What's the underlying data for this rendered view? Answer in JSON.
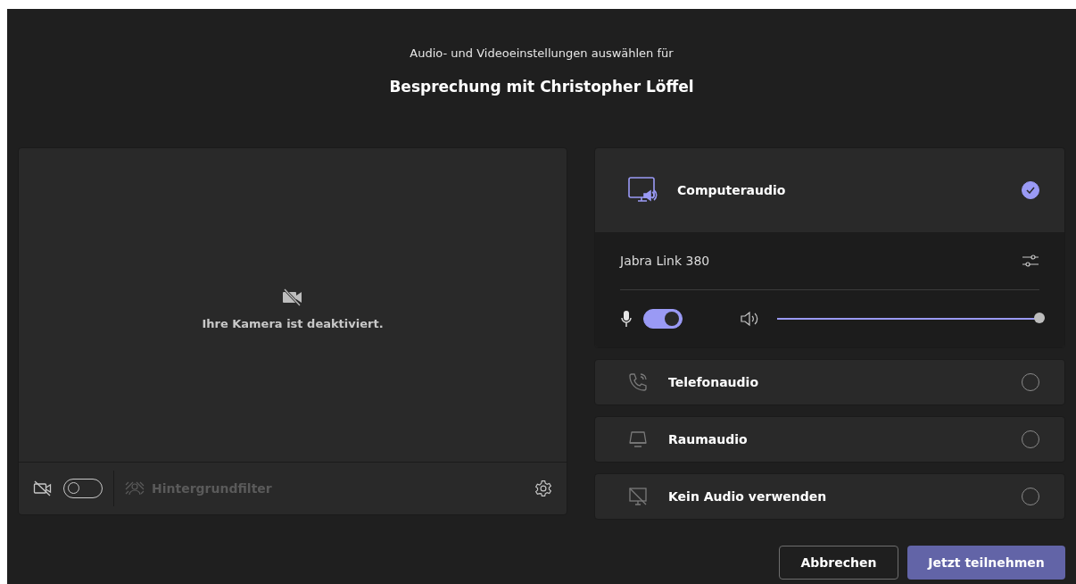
{
  "header": {
    "subtitle": "Audio- und Videoeinstellungen auswählen für",
    "title": "Besprechung mit Christopher Löffel"
  },
  "video": {
    "message": "Ihre Kamera ist deaktiviert.",
    "camera_on": false,
    "background_filter": {
      "label": "Hintergrundfilter",
      "disabled": true
    }
  },
  "audio_options": [
    {
      "kind": "computer",
      "label": "Computeraudio",
      "selected": true,
      "device": "Jabra Link 380",
      "mic_on": true,
      "volume": {
        "level": 1
      }
    },
    {
      "kind": "phone",
      "label": "Telefonaudio",
      "selected": false
    },
    {
      "kind": "room",
      "label": "Raumaudio",
      "selected": false
    },
    {
      "kind": "none",
      "label": "Kein Audio verwenden",
      "selected": false
    }
  ],
  "buttons": [
    {
      "label": "Abbrechen",
      "kind": "secondary"
    },
    {
      "label": "Jetzt teilnehmen",
      "kind": "primary"
    }
  ]
}
